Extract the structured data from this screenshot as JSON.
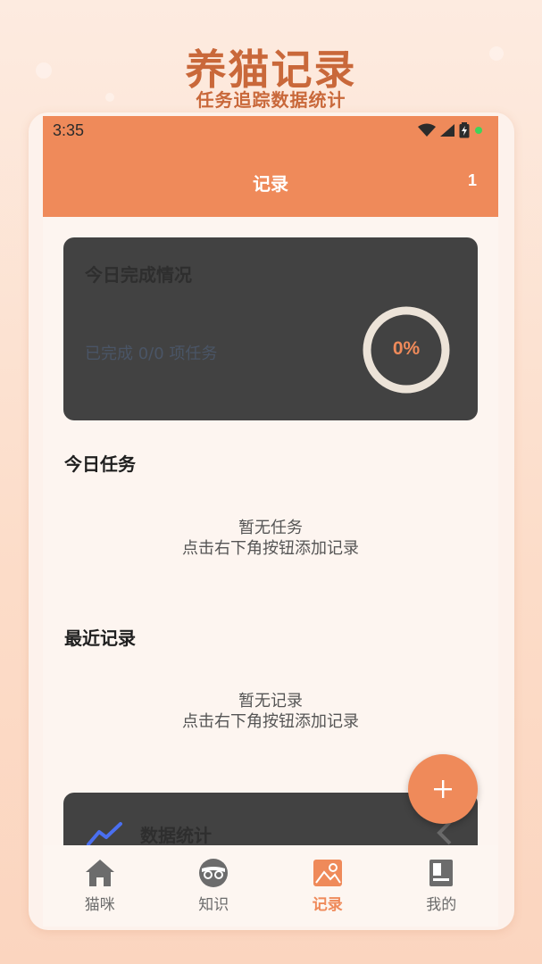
{
  "promo": {
    "title": "养猫记录",
    "subtitle": "任务追踪数据统计"
  },
  "status_bar": {
    "time": "3:35",
    "icons": [
      "wifi-icon",
      "signal-icon",
      "battery-icon",
      "dot-icon"
    ]
  },
  "app_bar": {
    "title": "记录",
    "count": "1"
  },
  "today_card": {
    "title": "今日完成情况",
    "subtitle": "已完成 0/0 项任务",
    "progress_label": "0%",
    "progress_fraction": 0
  },
  "today_tasks": {
    "heading": "今日任务",
    "empty_line1": "暂无任务",
    "empty_line2": "点击右下角按钮添加记录"
  },
  "recent": {
    "heading": "最近记录",
    "empty_line1": "暂无记录",
    "empty_line2": "点击右下角按钮添加记录"
  },
  "stats_card": {
    "title": "数据统计",
    "icon": "trend-chart-icon"
  },
  "fab": {
    "label": "+"
  },
  "nav": {
    "items": [
      {
        "label": "猫咪",
        "icon": "home-icon"
      },
      {
        "label": "知识",
        "icon": "cat-face-icon"
      },
      {
        "label": "记录",
        "icon": "image-icon"
      },
      {
        "label": "我的",
        "icon": "book-icon"
      }
    ],
    "active_index": 2
  },
  "colors": {
    "accent": "#ef8a5a",
    "card": "#424242",
    "background": "#fdf5f0"
  }
}
